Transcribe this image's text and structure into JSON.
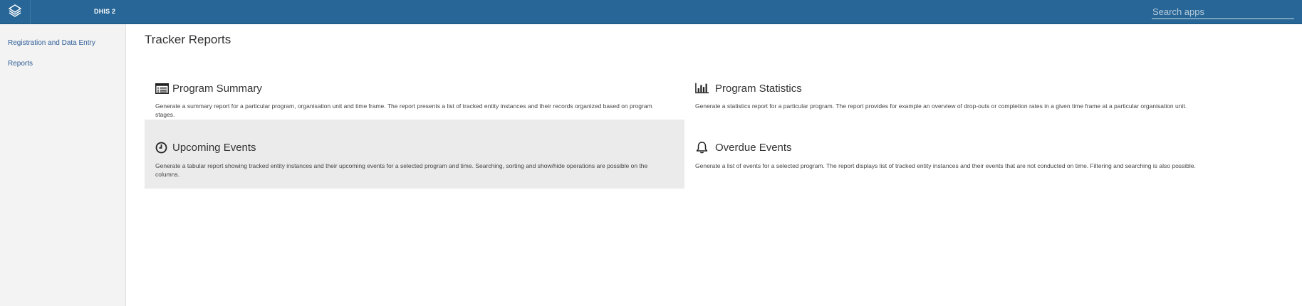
{
  "header": {
    "app_title": "DHIS 2",
    "logo_icon": "dhis2-logo-icon",
    "search_placeholder": "Search apps",
    "search_value": ""
  },
  "sidebar": {
    "items": [
      {
        "label": "Registration and Data Entry"
      },
      {
        "label": "Reports"
      }
    ]
  },
  "main": {
    "title": "Tracker Reports",
    "cards": [
      {
        "icon": "list-alt-icon",
        "title": "Program Summary",
        "description": "Generate a summary report for a particular program, organisation unit and time frame. The report presents a list of tracked entity instances and their records organized based on program stages."
      },
      {
        "icon": "bar-chart-icon",
        "title": "Program Statistics",
        "description": "Generate a statistics report for a particular program. The report provides for example an overview of drop-outs or completion rates in a given time frame at a particular organisation unit."
      },
      {
        "icon": "clock-icon",
        "title": "Upcoming Events",
        "description": "Generate a tabular report showing tracked entity instances and their upcoming events for a selected program and time. Searching, sorting and show/hide operations are possible on the columns."
      },
      {
        "icon": "bell-icon",
        "title": "Overdue Events",
        "description": "Generate a list of events for a selected program. The report displays list of tracked entity instances and their events that are not conducted on time. Filtering and searching is also possible."
      }
    ]
  },
  "colors": {
    "header_bg": "#276696",
    "sidebar_bg": "#f3f3f3",
    "link": "#2e5d97",
    "active_card_bg": "#ebebeb"
  }
}
